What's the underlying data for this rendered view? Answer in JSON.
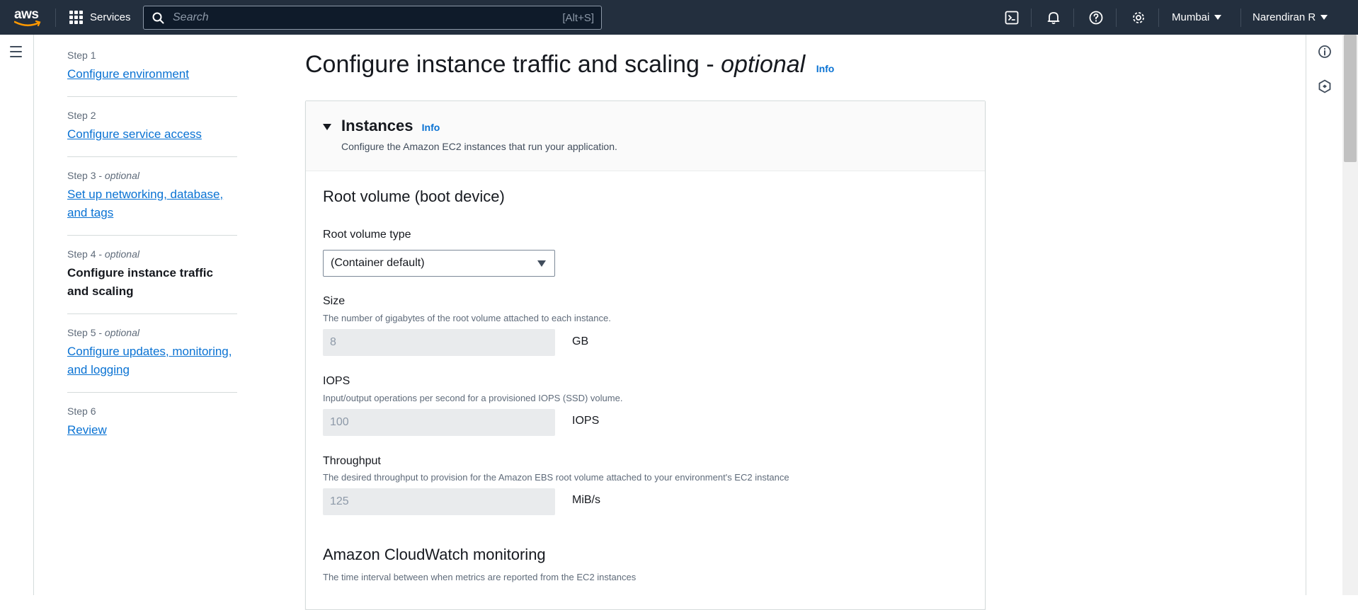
{
  "topnav": {
    "logo_text": "aws",
    "services_label": "Services",
    "search_placeholder": "Search",
    "search_shortcut": "[Alt+S]",
    "region": "Mumbai",
    "user": "Narendiran R"
  },
  "steps": [
    {
      "label": "Step 1",
      "optional": "",
      "title": "Configure environment",
      "current": false
    },
    {
      "label": "Step 2",
      "optional": "",
      "title": "Configure service access",
      "current": false
    },
    {
      "label": "Step 3 - ",
      "optional": "optional",
      "title": "Set up networking, database, and tags",
      "current": false
    },
    {
      "label": "Step 4 - ",
      "optional": "optional",
      "title": "Configure instance traffic and scaling",
      "current": true
    },
    {
      "label": "Step 5 - ",
      "optional": "optional",
      "title": "Configure updates, monitoring, and logging",
      "current": false
    },
    {
      "label": "Step 6",
      "optional": "",
      "title": "Review",
      "current": false
    }
  ],
  "page": {
    "title": "Configure instance traffic and scaling - ",
    "title_optional": "optional",
    "info": "Info"
  },
  "instances": {
    "title": "Instances",
    "info": "Info",
    "description": "Configure the Amazon EC2 instances that run your application.",
    "root_volume": {
      "heading": "Root volume (boot device)",
      "type_label": "Root volume type",
      "type_value": "(Container default)",
      "size_label": "Size",
      "size_desc": "The number of gigabytes of the root volume attached to each instance.",
      "size_placeholder": "8",
      "size_unit": "GB",
      "iops_label": "IOPS",
      "iops_desc": "Input/output operations per second for a provisioned IOPS (SSD) volume.",
      "iops_placeholder": "100",
      "iops_unit": "IOPS",
      "throughput_label": "Throughput",
      "throughput_desc": "The desired throughput to provision for the Amazon EBS root volume attached to your environment's EC2 instance",
      "throughput_placeholder": "125",
      "throughput_unit": "MiB/s"
    },
    "cloudwatch": {
      "heading": "Amazon CloudWatch monitoring",
      "desc": "The time interval between when metrics are reported from the EC2 instances"
    }
  },
  "colors": {
    "nav_bg": "#232f3e",
    "link": "#0972d3",
    "aws_orange": "#ff9900"
  }
}
